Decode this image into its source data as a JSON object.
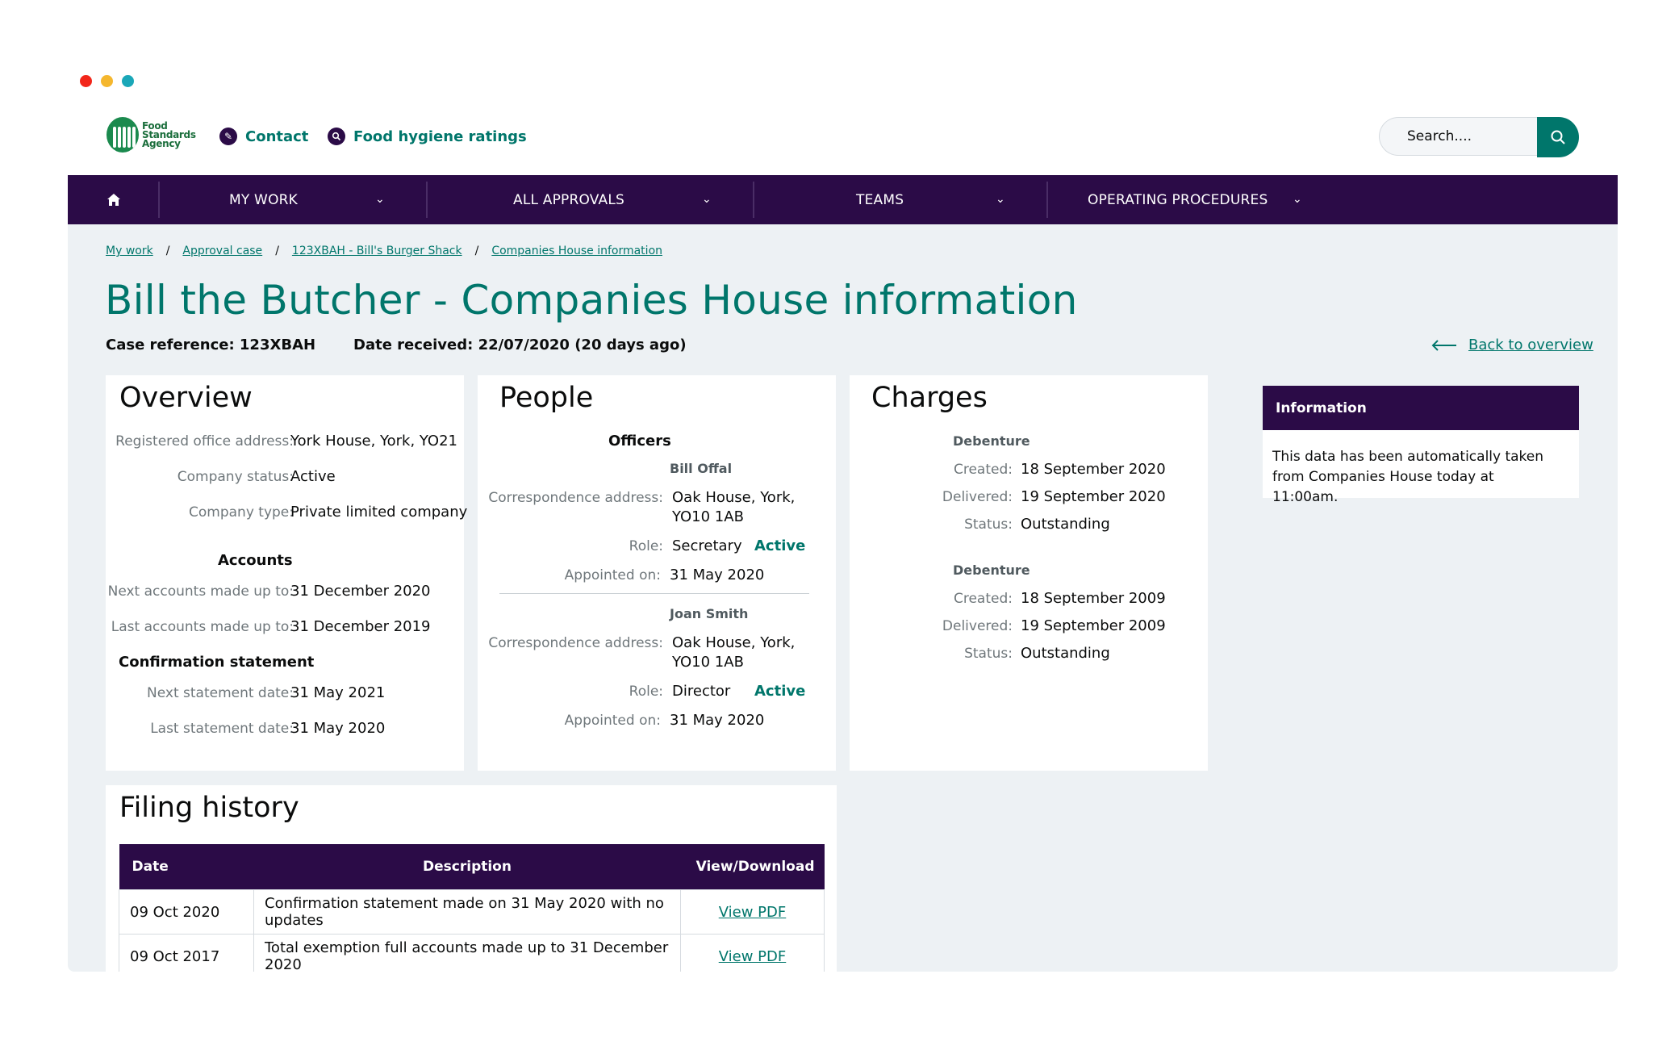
{
  "window": {
    "colors": {
      "red": "#f2261a",
      "yellow": "#f5b72e",
      "teal": "#1aa7b8"
    }
  },
  "header": {
    "logo_lines": [
      "Food",
      "Standards",
      "Agency"
    ],
    "links": [
      {
        "label": "Contact",
        "icon": "pen-icon"
      },
      {
        "label": "Food hygiene ratings",
        "icon": "search-icon"
      }
    ],
    "search": {
      "placeholder": "Search...."
    }
  },
  "nav": {
    "home_icon": "home-icon",
    "items": [
      {
        "label": "MY WORK"
      },
      {
        "label": "ALL APPROVALS"
      },
      {
        "label": "TEAMS"
      },
      {
        "label": "OPERATING PROCEDURES"
      }
    ]
  },
  "breadcrumb": [
    "My work",
    "Approval case",
    "123XBAH - Bill's Burger Shack",
    "Companies House information"
  ],
  "page": {
    "title": "Bill the Butcher - Companies House information",
    "case_reference": "Case reference: 123XBAH",
    "date_received": "Date received: 22/07/2020 (20 days ago)",
    "back_link": "Back to overview"
  },
  "overview": {
    "title": "Overview",
    "registered_office_label": "Registered office address:",
    "registered_office": "York House, York, YO21",
    "status_label": "Company status:",
    "status": "Active",
    "type_label": "Company type:",
    "type": "Private limited company",
    "accounts_heading": "Accounts",
    "next_accounts_label": "Next accounts made up to:",
    "next_accounts": "31 December 2020",
    "last_accounts_label": "Last accounts made up to:",
    "last_accounts": "31 December 2019",
    "confirmation_heading": "Confirmation statement",
    "next_statement_label": "Next statement date:",
    "next_statement": "31 May 2021",
    "last_statement_label": "Last statement date:",
    "last_statement": "31 May 2020"
  },
  "people": {
    "title": "People",
    "officers_heading": "Officers",
    "officers": [
      {
        "name": "Bill Offal",
        "address_label": "Correspondence address:",
        "address_line1": "Oak House, York,",
        "address_line2": "YO10 1AB",
        "role_label": "Role:",
        "role": "Secretary",
        "status": "Active",
        "appointed_label": "Appointed on:",
        "appointed": "31 May 2020"
      },
      {
        "name": "Joan Smith",
        "address_label": "Correspondence address:",
        "address_line1": "Oak House, York,",
        "address_line2": "YO10 1AB",
        "role_label": "Role:",
        "role": "Director",
        "status": "Active",
        "appointed_label": "Appointed on:",
        "appointed": "31 May 2020"
      }
    ]
  },
  "charges": {
    "title": "Charges",
    "items": [
      {
        "type": "Debenture",
        "created_label": "Created:",
        "created": "18 September 2020",
        "delivered_label": "Delivered:",
        "delivered": "19 September 2020",
        "status_label": "Status:",
        "status": "Outstanding"
      },
      {
        "type": "Debenture",
        "created_label": "Created:",
        "created": "18 September 2009",
        "delivered_label": "Delivered:",
        "delivered": "19 September 2009",
        "status_label": "Status:",
        "status": "Outstanding"
      }
    ]
  },
  "information": {
    "heading": "Information",
    "text": "This data has been automatically taken from Companies House today at 11:00am."
  },
  "filing_history": {
    "title": "Filing history",
    "columns": [
      "Date",
      "Description",
      "View/Download"
    ],
    "rows": [
      {
        "date": "09 Oct 2020",
        "description": "Confirmation statement made on 31 May 2020 with no updates",
        "link": "View PDF"
      },
      {
        "date": "09 Oct 2017",
        "description": "Total exemption full accounts made up to 31 December 2020",
        "link": "View PDF"
      }
    ]
  }
}
